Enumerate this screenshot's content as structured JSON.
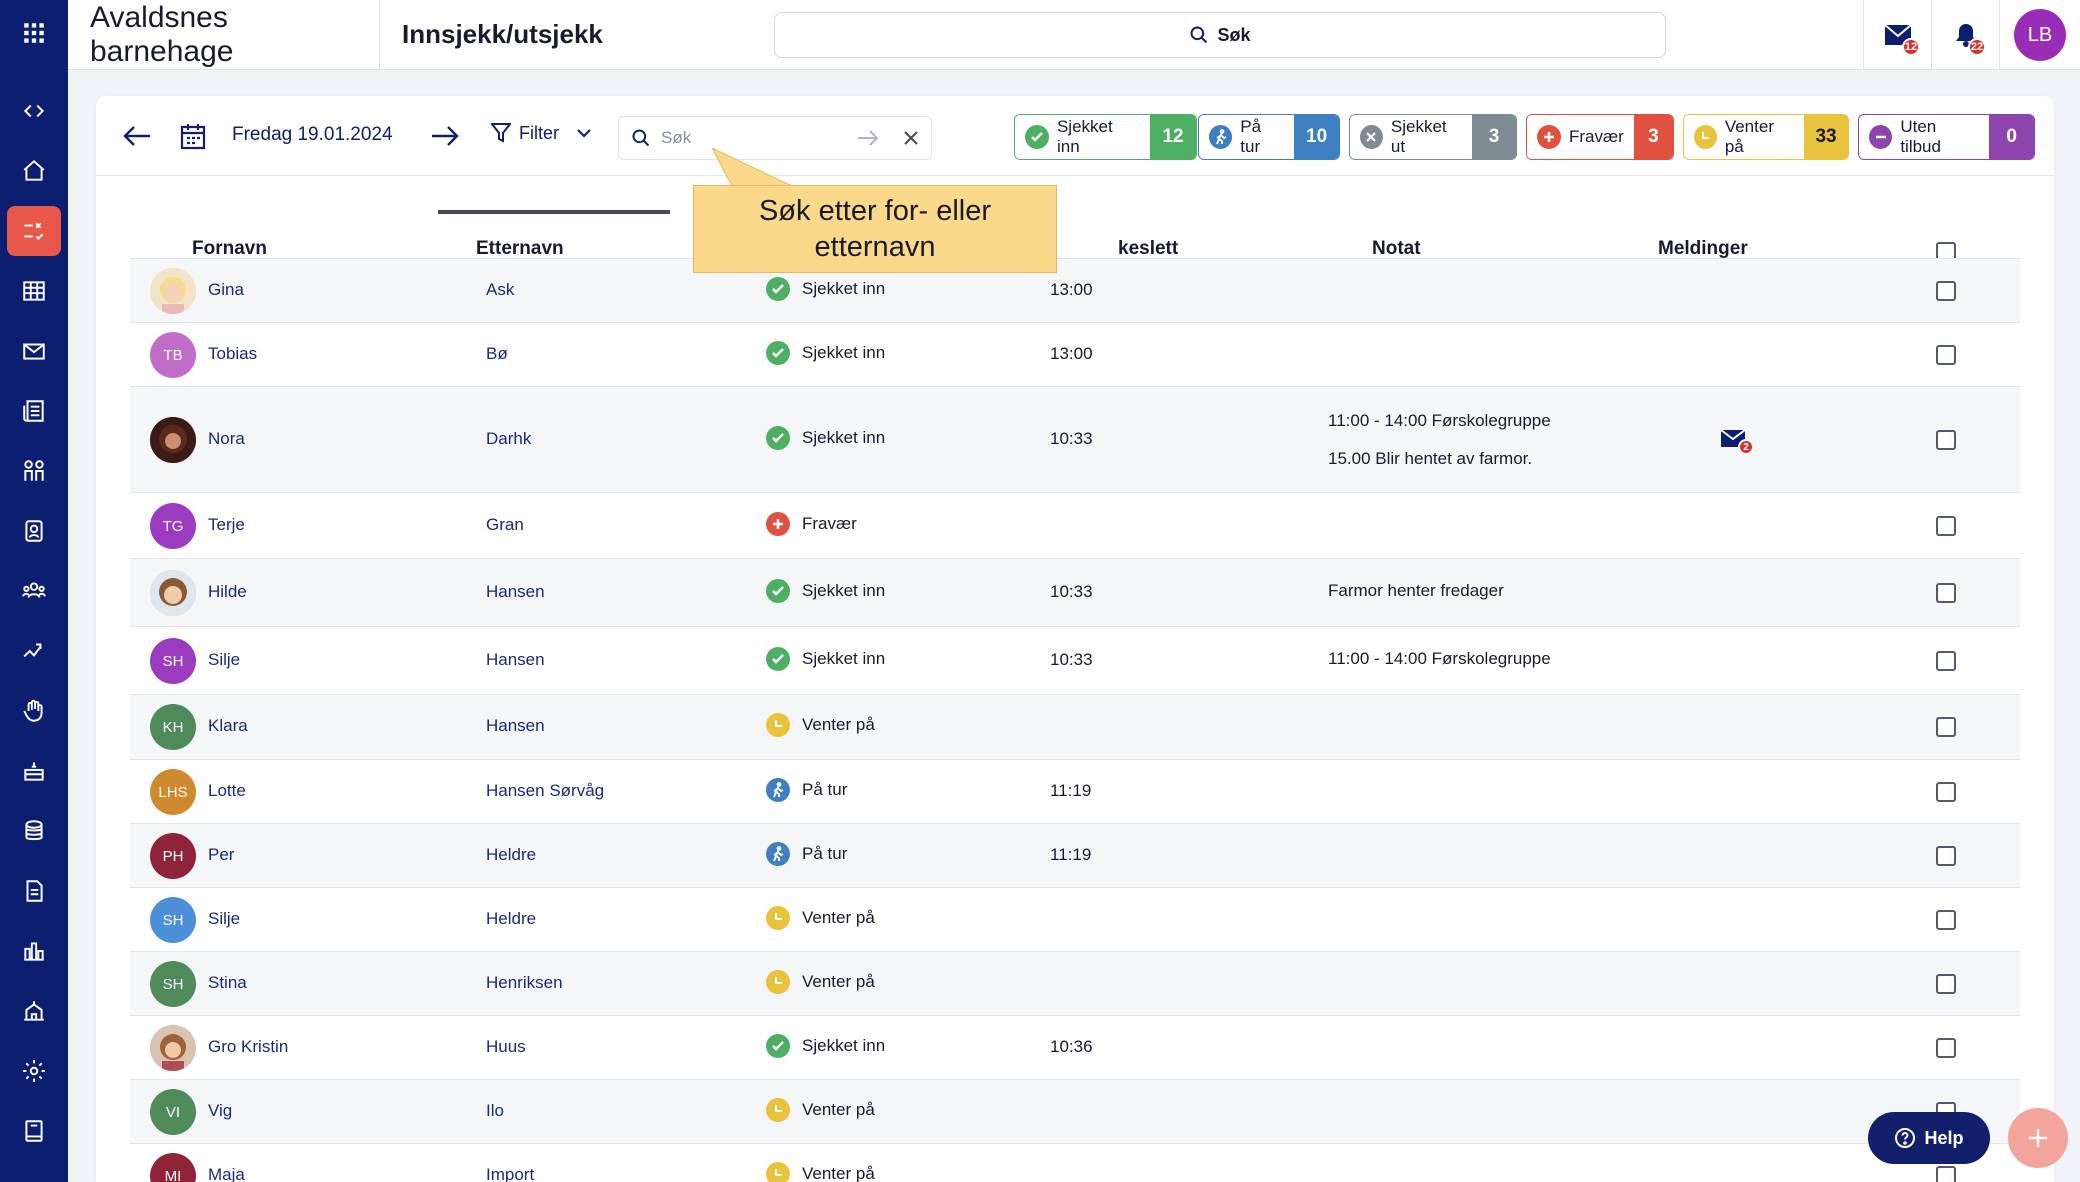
{
  "app": {
    "org_name": "Avaldsnes barnehage",
    "page_title": "Innsjekk/utsjekk"
  },
  "header": {
    "search_label": "Søk",
    "mail_badge": "12",
    "bell_badge": "22",
    "avatar_initials": "LB"
  },
  "toolbar": {
    "date_label": "Fredag 19.01.2024",
    "filter_label": "Filter",
    "search_placeholder": "Søk"
  },
  "status_pills": [
    {
      "label": "Sjekket inn",
      "count": "12",
      "color": "#4caf63"
    },
    {
      "label": "På tur",
      "count": "10",
      "color": "#3d7fc1"
    },
    {
      "label": "Sjekket ut",
      "count": "3",
      "color": "#7f8b93"
    },
    {
      "label": "Fravær",
      "count": "3",
      "color": "#e0523f"
    },
    {
      "label": "Venter på",
      "count": "33",
      "color": "#e8c33b"
    },
    {
      "label": "Uten tilbud",
      "count": "0",
      "color": "#8e44ad"
    }
  ],
  "table": {
    "columns": {
      "first": "Fornavn",
      "last": "Etternavn",
      "time": "keslett",
      "note": "Notat",
      "messages": "Meldinger"
    },
    "rows": [
      {
        "initials": "",
        "photo": "blonde",
        "first": "Gina",
        "last": "Ask",
        "status": "Sjekket inn",
        "time": "13:00",
        "note1": "",
        "note2": ""
      },
      {
        "initials": "TB",
        "avatar_color": "#c06ec8",
        "first": "Tobias",
        "last": "Bø",
        "status": "Sjekket inn",
        "time": "13:00",
        "note1": "",
        "note2": ""
      },
      {
        "initials": "",
        "photo": "dark",
        "first": "Nora",
        "last": "Darhk",
        "status": "Sjekket inn",
        "time": "10:33",
        "note1": "11:00 - 14:00 Førskolegruppe",
        "note2": "15.00 Blir hentet av farmor.",
        "msg_count": "2"
      },
      {
        "initials": "TG",
        "avatar_color": "#9b3cc0",
        "first": "Terje",
        "last": "Gran",
        "status": "Fravær",
        "time": "",
        "note1": "",
        "note2": ""
      },
      {
        "initials": "",
        "photo": "girl",
        "first": "Hilde",
        "last": "Hansen",
        "status": "Sjekket inn",
        "time": "10:33",
        "note1": "Farmor henter fredager",
        "note2": ""
      },
      {
        "initials": "SH",
        "avatar_color": "#9b3cc0",
        "first": "Silje",
        "last": "Hansen",
        "status": "Sjekket inn",
        "time": "10:33",
        "note1": "11:00 - 14:00 Førskolegruppe",
        "note2": ""
      },
      {
        "initials": "KH",
        "avatar_color": "#4f8a5b",
        "first": "Klara",
        "last": "Hansen",
        "status": "Venter på",
        "time": "",
        "note1": "",
        "note2": ""
      },
      {
        "initials": "LHS",
        "avatar_color": "#cf8a2e",
        "first": "Lotte",
        "last": "Hansen Sørvåg",
        "status": "På tur",
        "time": "11:19",
        "note1": "",
        "note2": ""
      },
      {
        "initials": "PH",
        "avatar_color": "#8f2337",
        "first": "Per",
        "last": "Heldre",
        "status": "På tur",
        "time": "11:19",
        "note1": "",
        "note2": ""
      },
      {
        "initials": "SH",
        "avatar_color": "#4a8fd8",
        "first": "Silje",
        "last": "Heldre",
        "status": "Venter på",
        "time": "",
        "note1": "",
        "note2": ""
      },
      {
        "initials": "SH",
        "avatar_color": "#4f8a5b",
        "first": "Stina",
        "last": "Henriksen",
        "status": "Venter på",
        "time": "",
        "note1": "",
        "note2": ""
      },
      {
        "initials": "",
        "photo": "kid",
        "first": "Gro Kristin",
        "last": "Huus",
        "status": "Sjekket inn",
        "time": "10:36",
        "note1": "",
        "note2": ""
      },
      {
        "initials": "VI",
        "avatar_color": "#4f8a5b",
        "first": "Vig",
        "last": "Ilo",
        "status": "Venter på",
        "time": "",
        "note1": "",
        "note2": ""
      },
      {
        "initials": "MI",
        "avatar_color": "#8f2337",
        "first": "Maja",
        "last": "Import",
        "status": "Venter på",
        "time": "",
        "note1": "",
        "note2": ""
      }
    ]
  },
  "tooltip": {
    "text": "Søk etter for- eller etternavn"
  },
  "help": {
    "label": "Help"
  }
}
